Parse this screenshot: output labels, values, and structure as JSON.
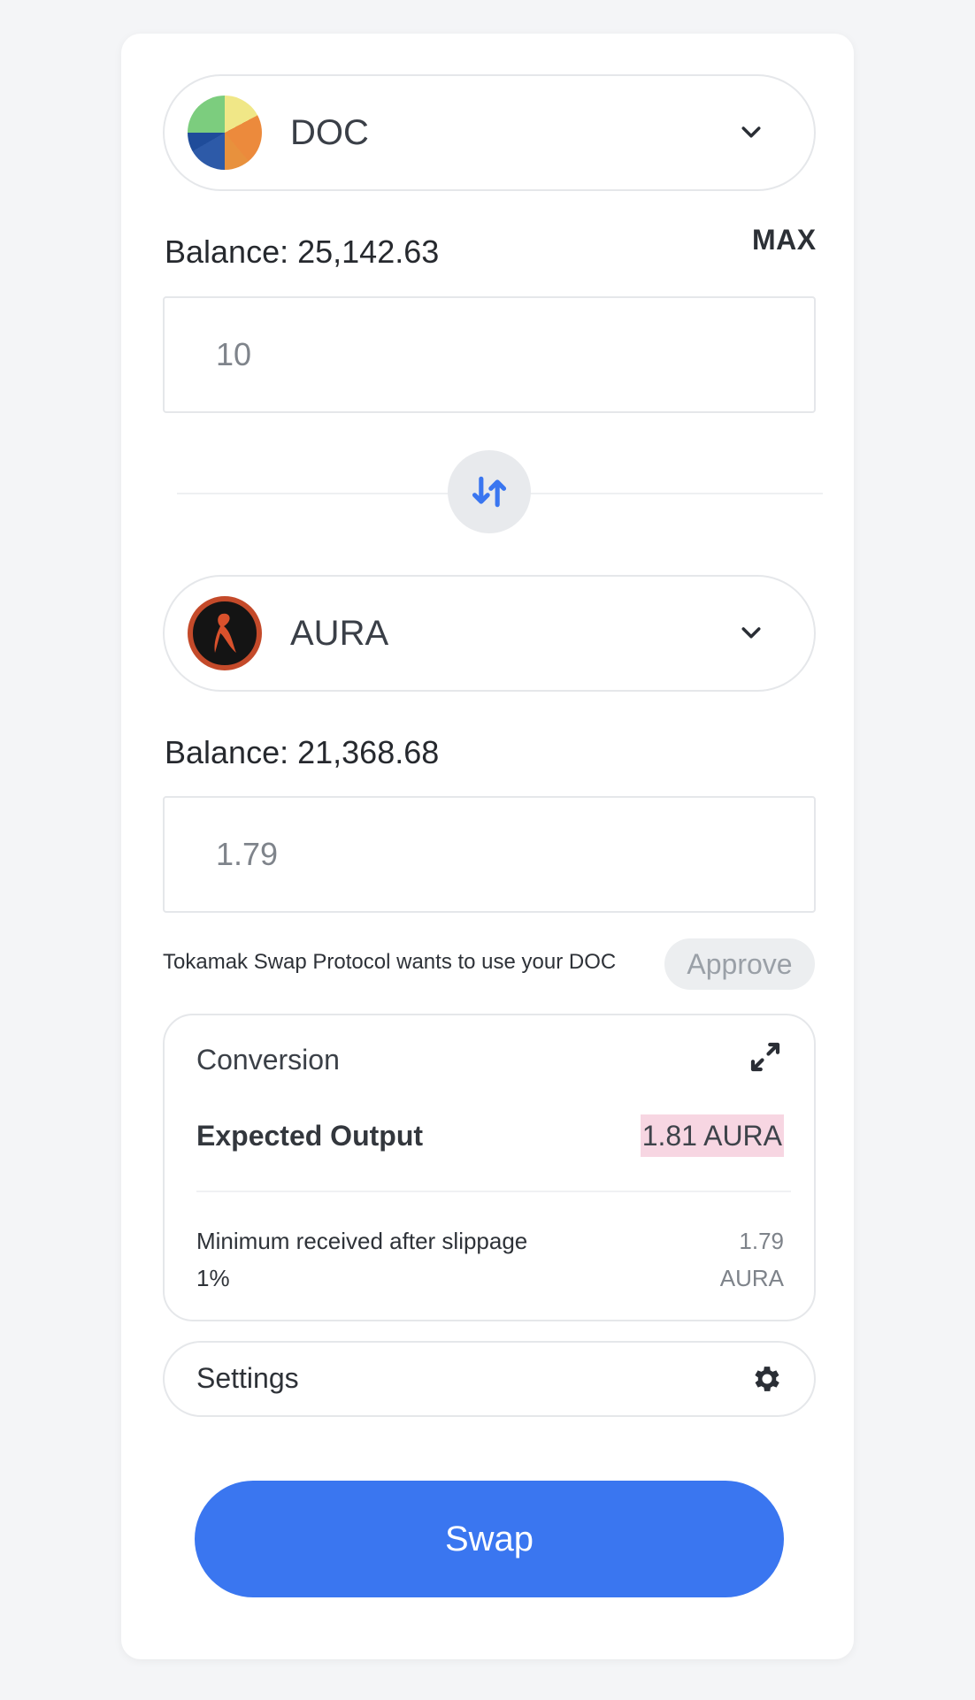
{
  "from": {
    "token": "DOC",
    "balance": "Balance: 25,142.63",
    "max_label": "MAX",
    "amount": "10"
  },
  "to": {
    "token": "AURA",
    "balance": "Balance: 21,368.68",
    "amount": "1.79"
  },
  "approve": {
    "note": "Tokamak Swap Protocol wants to use your DOC",
    "button_label": "Approve"
  },
  "conversion": {
    "title": "Conversion",
    "expected_output_label": "Expected Output",
    "expected_output_value": "1.81 AURA",
    "min_received_label_line1": "Minimum received after slippage",
    "min_received_label_line2": "1%",
    "min_received_value_line1": "1.79",
    "min_received_value_line2": "AURA"
  },
  "settings": {
    "label": "Settings"
  },
  "swap_button": {
    "label": "Swap"
  },
  "icons": {
    "from_token": "doc-token-icon",
    "to_token": "aura-token-icon",
    "dropdown": "chevron-down-icon",
    "switch": "swap-direction-icon",
    "expand": "expand-icon",
    "settings": "gear-icon"
  },
  "colors": {
    "primary": "#3a76f0",
    "highlight": "#f7d6e2",
    "aura_logo_ring": "#c44a2a"
  }
}
